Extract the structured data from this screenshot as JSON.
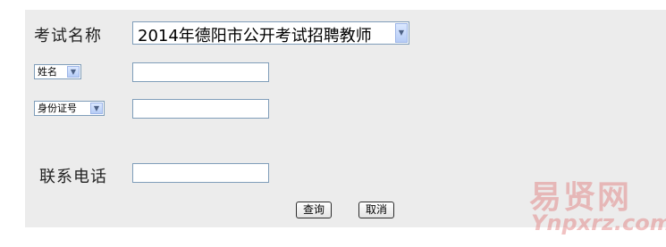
{
  "form": {
    "exam_name_label": "考试名称",
    "exam_name_value": "2014年德阳市公开考试招聘教师",
    "name_type_value": "姓名",
    "id_type_value": "身份证号",
    "name_value": "",
    "id_value": "",
    "phone_label": "联系电话",
    "phone_value": "",
    "query_button": "查询",
    "cancel_button": "取消"
  },
  "watermark": {
    "text_cn": "易贤网",
    "text_en": "Ynpxrz.com"
  },
  "colors": {
    "panel_background": "#ececec",
    "input_border": "#7f9db9",
    "watermark": "#e17878"
  }
}
